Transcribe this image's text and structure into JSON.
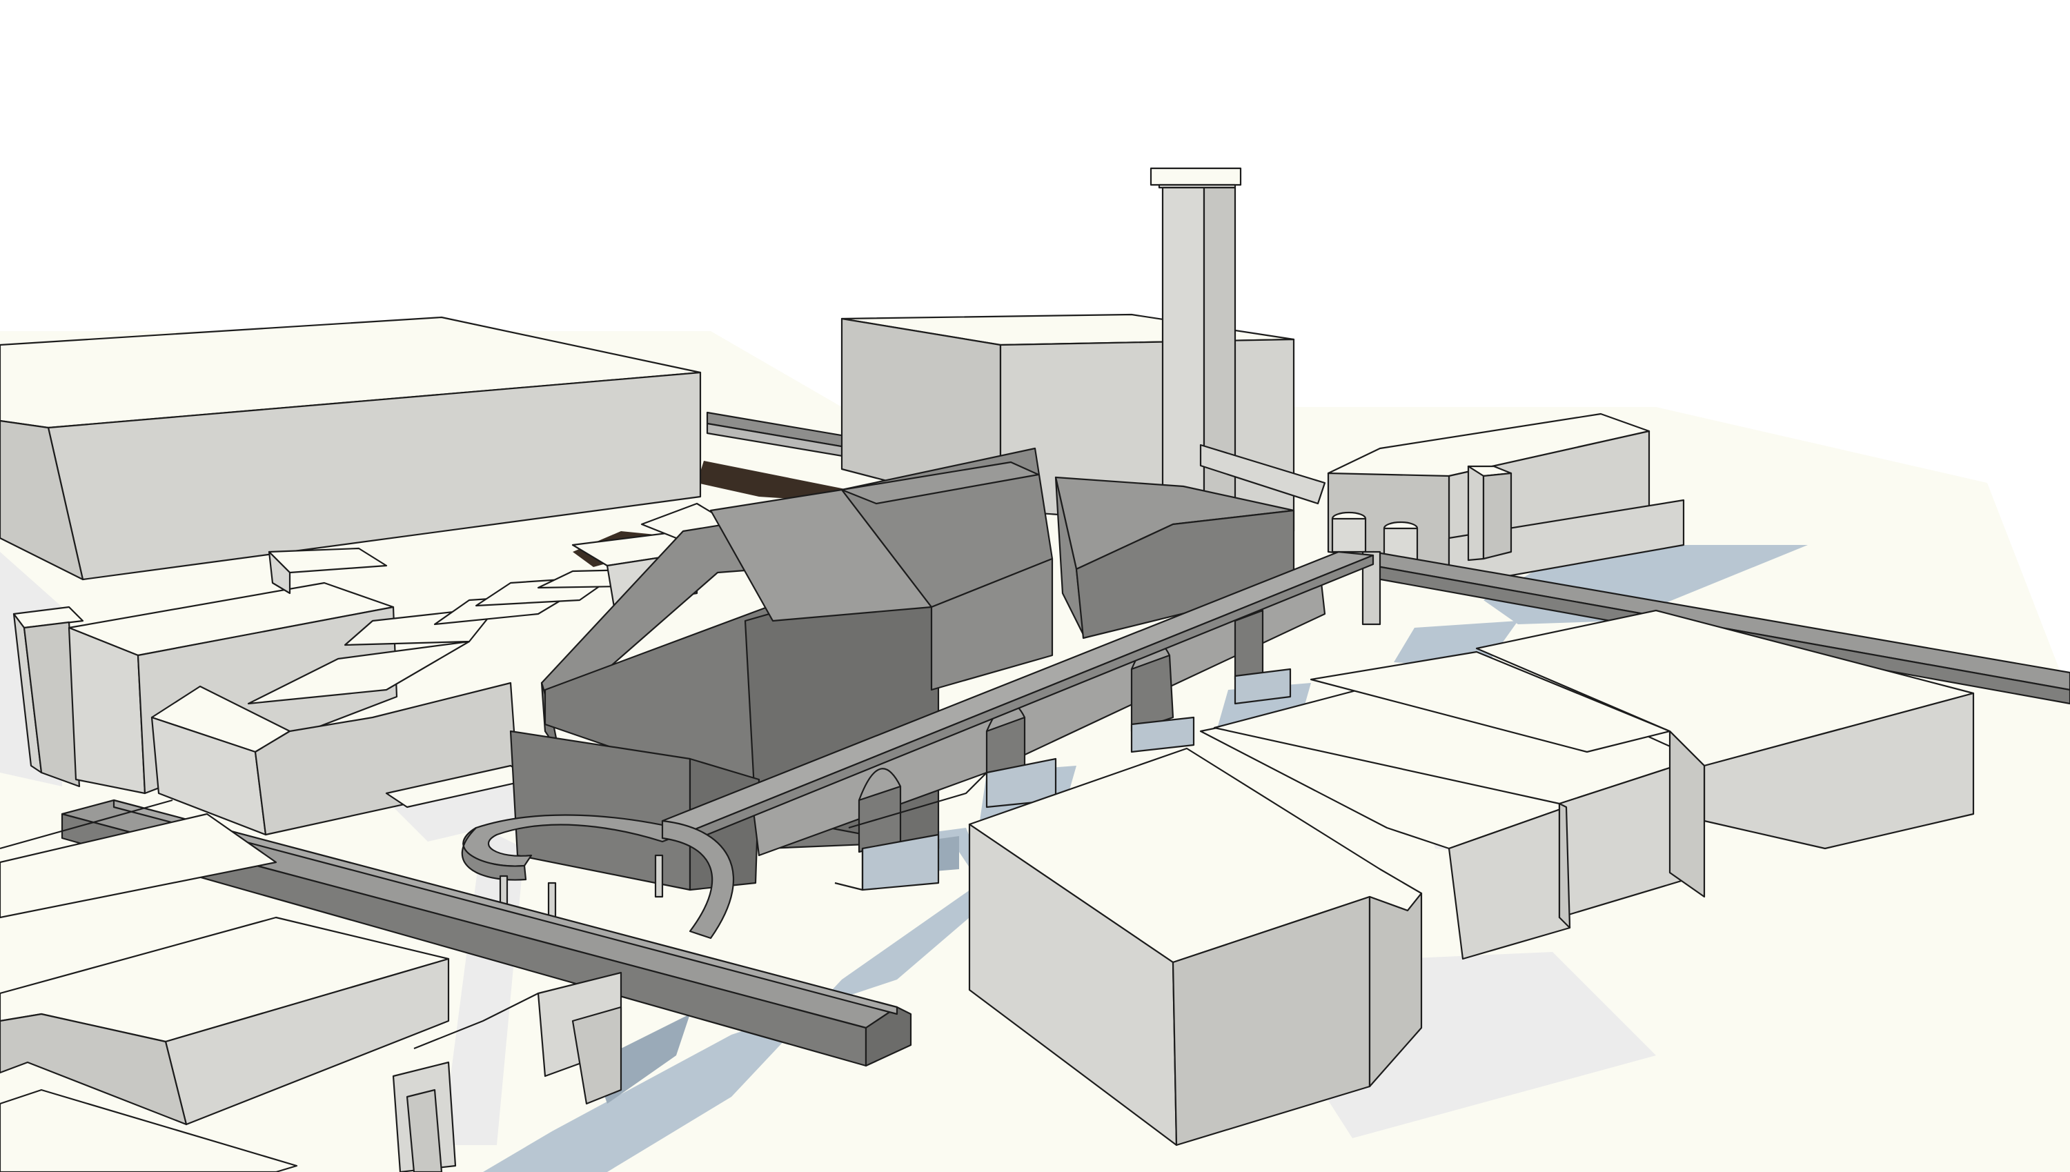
{
  "scene": {
    "view": "3d-massing-model",
    "style": "monochrome-sketch",
    "colors": {
      "background": "#ffffff",
      "ground": "#fbfbf2",
      "roof": "#fbfbf2",
      "wall_light": "#dadad6",
      "wall_mid": "#c9c9c5",
      "wall_dark": "#bdbdb9",
      "shadow": "#ececec",
      "proposed_light": "#9a9a98",
      "proposed_mid": "#838381",
      "proposed_dark": "#6f6f6d",
      "water": "#b8c6d2",
      "water_shadow": "#9aaab8",
      "dark_ground": "#3b2e24",
      "edge": "#1c1c1c"
    }
  }
}
